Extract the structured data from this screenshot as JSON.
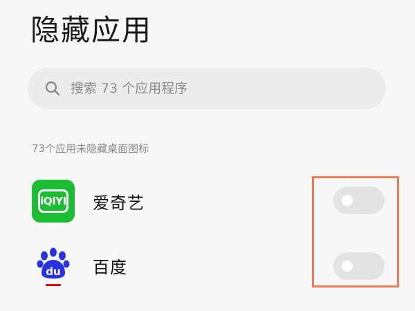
{
  "header": {
    "title": "隐藏应用"
  },
  "search": {
    "placeholder": "搜索 73 个应用程序",
    "value": ""
  },
  "section": {
    "caption": "73个应用未隐藏桌面图标"
  },
  "apps": [
    {
      "name": "爱奇艺",
      "icon": "iqiyi-app-icon",
      "icon_text": "iQIYI",
      "hidden": false
    },
    {
      "name": "百度",
      "icon": "baidu-app-icon",
      "icon_text": "du",
      "hidden": false
    }
  ],
  "colors": {
    "background": "#f7f7f7",
    "search_bg": "#ececec",
    "toggle_off": "#e3e3e3",
    "highlight": "#f07b52",
    "iqiyi_green": "#1bbd32",
    "baidu_blue": "#2932e1",
    "baidu_red": "#e10602"
  }
}
